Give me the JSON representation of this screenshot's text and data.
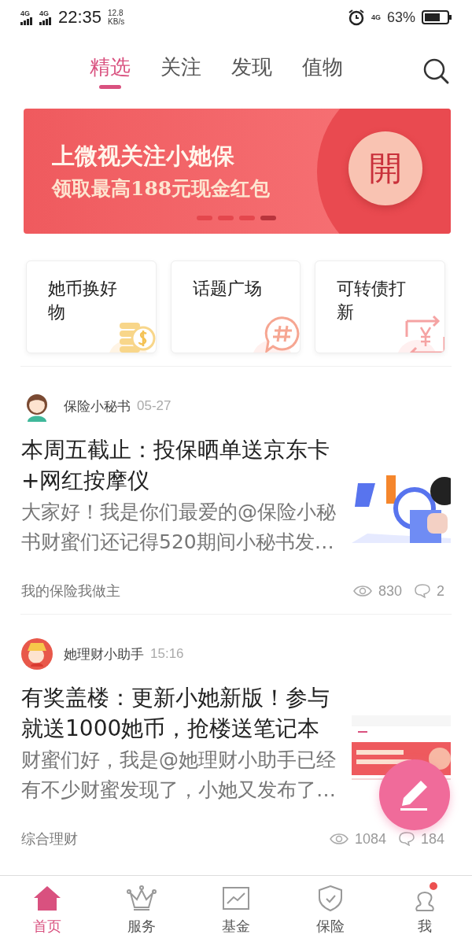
{
  "status_bar": {
    "signal_labels": [
      "4G",
      "4G"
    ],
    "time": "22:35",
    "speed": "12.8",
    "speed_unit": "KB/s",
    "net": "4G",
    "battery": "63%"
  },
  "tabs": [
    {
      "label": "精选",
      "selected": true
    },
    {
      "label": "关注",
      "selected": false
    },
    {
      "label": "发现",
      "selected": false
    },
    {
      "label": "值物",
      "selected": false
    }
  ],
  "banner": {
    "line1": "上微视关注小她保",
    "line2": "领取最高188元现金红包",
    "seal": "開",
    "dots": [
      {
        "selected": false
      },
      {
        "selected": false
      },
      {
        "selected": false
      },
      {
        "selected": true
      }
    ]
  },
  "shortcuts": [
    {
      "label": "她币换好物",
      "kind": "coins"
    },
    {
      "label": "话题广场",
      "kind": "topic"
    },
    {
      "label": "可转债打新",
      "kind": "exchange"
    }
  ],
  "posts": [
    {
      "author": "保险小秘书",
      "time": "05-27",
      "title": "本周五截止：投保晒单送京东卡+网红按摩仪",
      "summary": "大家好！我是你们最爱的@保险小秘书财蜜们还记得520期间小秘书发…",
      "tag": "我的保险我做主",
      "views": "830",
      "comments": "2"
    },
    {
      "author": "她理财小助手",
      "time": "15:16",
      "title": "有奖盖楼：更新小她新版！参与就送1000她币，抢楼送笔记本",
      "summary": "财蜜们好，我是@她理财小助手已经有不少财蜜发现了，小她又发布了…",
      "tag": "综合理财",
      "views": "1084",
      "comments": "184"
    }
  ],
  "nav": [
    {
      "label": "首页",
      "selected": true,
      "badge": false
    },
    {
      "label": "服务",
      "selected": false,
      "badge": false
    },
    {
      "label": "基金",
      "selected": false,
      "badge": false
    },
    {
      "label": "保险",
      "selected": false,
      "badge": false
    },
    {
      "label": "我",
      "selected": false,
      "badge": true
    }
  ]
}
